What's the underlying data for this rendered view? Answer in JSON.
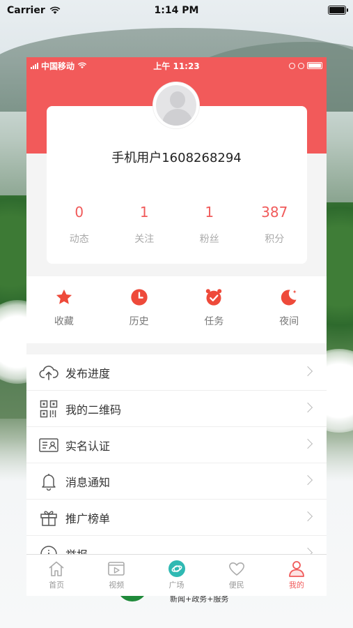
{
  "outer_status": {
    "carrier": "Carrier",
    "time": "1:14 PM"
  },
  "inner_status": {
    "carrier": "中国移动",
    "time": "上午 11:23"
  },
  "profile": {
    "username": "手机用户1608268294",
    "stats": [
      {
        "value": "0",
        "label": "动态"
      },
      {
        "value": "1",
        "label": "关注"
      },
      {
        "value": "1",
        "label": "粉丝"
      },
      {
        "value": "387",
        "label": "积分"
      }
    ]
  },
  "quick_actions": [
    {
      "label": "收藏",
      "icon": "star-icon"
    },
    {
      "label": "历史",
      "icon": "clock-icon"
    },
    {
      "label": "任务",
      "icon": "alarm-icon"
    },
    {
      "label": "夜间",
      "icon": "moon-icon"
    }
  ],
  "menu": [
    {
      "label": "发布进度",
      "icon": "cloud-upload-icon"
    },
    {
      "label": "我的二维码",
      "icon": "qr-code-icon"
    },
    {
      "label": "实名认证",
      "icon": "id-card-icon"
    },
    {
      "label": "消息通知",
      "icon": "bell-icon"
    },
    {
      "label": "推广榜单",
      "icon": "gift-icon"
    },
    {
      "label": "举报",
      "icon": "info-icon"
    }
  ],
  "tabbar": [
    {
      "label": "首页",
      "icon": "home-icon",
      "active": false
    },
    {
      "label": "视频",
      "icon": "video-icon",
      "active": false
    },
    {
      "label": "广场",
      "icon": "globe-icon",
      "active": false
    },
    {
      "label": "便民",
      "icon": "heart-icon",
      "active": false
    },
    {
      "label": "我的",
      "icon": "user-icon",
      "active": true
    }
  ],
  "brand": {
    "slogan": "新闻+政务+服务"
  },
  "colors": {
    "accent": "#f25a5a",
    "tab_active": "#f05a5a",
    "brand_green": "#1f8a3a"
  }
}
